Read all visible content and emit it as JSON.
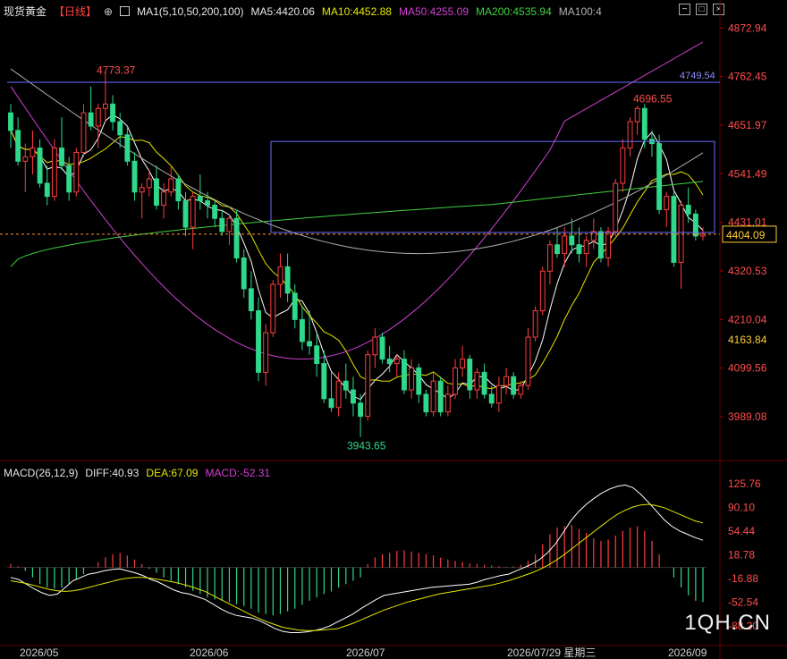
{
  "header": {
    "symbol": "现货黄金",
    "period": "【日线】",
    "ma_def": "MA1(5,10,50,200,100)",
    "ma5": "MA5:4420.06",
    "ma10": "MA10:4452.88",
    "ma50": "MA50:4255.09",
    "ma200": "MA200:4535.94",
    "ma100": "MA100:4"
  },
  "macd_header": {
    "name": "MACD(26,12,9)",
    "diff": "DIFF:40.93",
    "dea": "DEA:67.09",
    "macd": "MACD:-52.31"
  },
  "colors": {
    "up": "#ff3d3d",
    "down": "#2fd88a",
    "ma5": "#ffffff",
    "ma10": "#e6e600",
    "ma50": "#d040d0",
    "ma200": "#40d040",
    "ma100": "#b0b0b0",
    "rect": "#6a6aff",
    "hline": "#6a6aff",
    "last": "#ffcc33"
  },
  "watermark": "1QH.CN",
  "chart_data": {
    "type": "candlestick",
    "y_ticks": [
      "4872.94",
      "4762.45",
      "4651.97",
      "4541.49",
      "4431.01",
      "4320.53",
      "4210.04",
      "4099.56",
      "3989.08"
    ],
    "ylim": [
      3920,
      4900
    ],
    "x_labels": [
      "2026/05",
      "2026/06",
      "2026/07",
      "2026/07/29 星期三",
      "2026/09"
    ],
    "annotations": {
      "high1": "4773.37",
      "high2": "4696.55",
      "low": "3943.65",
      "hline": "4749.54",
      "last": "4404.09",
      "level": "4163.84"
    },
    "candles": [
      [
        4680,
        4700,
        4600,
        4640
      ],
      [
        4640,
        4670,
        4560,
        4570
      ],
      [
        4570,
        4610,
        4500,
        4580
      ],
      [
        4580,
        4640,
        4540,
        4600
      ],
      [
        4600,
        4620,
        4510,
        4520
      ],
      [
        4520,
        4560,
        4470,
        4490
      ],
      [
        4490,
        4620,
        4480,
        4600
      ],
      [
        4600,
        4670,
        4550,
        4560
      ],
      [
        4560,
        4580,
        4480,
        4500
      ],
      [
        4500,
        4600,
        4490,
        4590
      ],
      [
        4590,
        4700,
        4580,
        4680
      ],
      [
        4680,
        4740,
        4640,
        4650
      ],
      [
        4650,
        4700,
        4600,
        4690
      ],
      [
        4690,
        4773,
        4660,
        4700
      ],
      [
        4700,
        4720,
        4640,
        4660
      ],
      [
        4660,
        4680,
        4600,
        4630
      ],
      [
        4630,
        4650,
        4560,
        4570
      ],
      [
        4570,
        4590,
        4480,
        4500
      ],
      [
        4500,
        4520,
        4440,
        4510
      ],
      [
        4510,
        4550,
        4490,
        4530
      ],
      [
        4530,
        4560,
        4460,
        4470
      ],
      [
        4470,
        4520,
        4440,
        4500
      ],
      [
        4500,
        4560,
        4490,
        4530
      ],
      [
        4530,
        4540,
        4460,
        4480
      ],
      [
        4480,
        4500,
        4400,
        4420
      ],
      [
        4420,
        4500,
        4370,
        4490
      ],
      [
        4490,
        4540,
        4460,
        4480
      ],
      [
        4480,
        4500,
        4440,
        4470
      ],
      [
        4470,
        4480,
        4420,
        4440
      ],
      [
        4440,
        4460,
        4400,
        4410
      ],
      [
        4410,
        4450,
        4380,
        4440
      ],
      [
        4440,
        4460,
        4340,
        4350
      ],
      [
        4350,
        4370,
        4260,
        4280
      ],
      [
        4280,
        4320,
        4210,
        4230
      ],
      [
        4230,
        4260,
        4070,
        4090
      ],
      [
        4090,
        4200,
        4060,
        4180
      ],
      [
        4180,
        4300,
        4170,
        4290
      ],
      [
        4290,
        4360,
        4260,
        4330
      ],
      [
        4330,
        4360,
        4250,
        4270
      ],
      [
        4270,
        4290,
        4190,
        4210
      ],
      [
        4210,
        4240,
        4140,
        4160
      ],
      [
        4160,
        4230,
        4130,
        4150
      ],
      [
        4150,
        4180,
        4080,
        4110
      ],
      [
        4110,
        4140,
        4020,
        4030
      ],
      [
        4030,
        4090,
        4000,
        4010
      ],
      [
        4010,
        4090,
        3990,
        4070
      ],
      [
        4070,
        4110,
        4030,
        4050
      ],
      [
        4050,
        4080,
        3990,
        4020
      ],
      [
        4020,
        4040,
        3943,
        3990
      ],
      [
        3990,
        4140,
        3980,
        4130
      ],
      [
        4130,
        4190,
        4100,
        4170
      ],
      [
        4170,
        4180,
        4110,
        4120
      ],
      [
        4120,
        4150,
        4090,
        4110
      ],
      [
        4110,
        4130,
        4080,
        4120
      ],
      [
        4120,
        4140,
        4040,
        4050
      ],
      [
        4050,
        4120,
        4030,
        4100
      ],
      [
        4100,
        4110,
        4020,
        4040
      ],
      [
        4040,
        4050,
        3990,
        4000
      ],
      [
        4000,
        4090,
        3990,
        4070
      ],
      [
        4070,
        4080,
        3990,
        4000
      ],
      [
        4000,
        4060,
        3990,
        4040
      ],
      [
        4040,
        4120,
        4030,
        4100
      ],
      [
        4100,
        4150,
        4080,
        4120
      ],
      [
        4120,
        4130,
        4030,
        4050
      ],
      [
        4050,
        4100,
        4030,
        4090
      ],
      [
        4090,
        4110,
        4030,
        4040
      ],
      [
        4040,
        4060,
        4010,
        4020
      ],
      [
        4020,
        4080,
        4000,
        4060
      ],
      [
        4060,
        4100,
        4040,
        4080
      ],
      [
        4080,
        4090,
        4030,
        4040
      ],
      [
        4040,
        4070,
        4030,
        4060
      ],
      [
        4060,
        4190,
        4050,
        4170
      ],
      [
        4170,
        4240,
        4160,
        4230
      ],
      [
        4230,
        4330,
        4220,
        4320
      ],
      [
        4320,
        4390,
        4290,
        4380
      ],
      [
        4380,
        4420,
        4350,
        4360
      ],
      [
        4360,
        4420,
        4330,
        4400
      ],
      [
        4400,
        4440,
        4360,
        4380
      ],
      [
        4380,
        4420,
        4340,
        4360
      ],
      [
        4360,
        4400,
        4330,
        4390
      ],
      [
        4390,
        4440,
        4370,
        4410
      ],
      [
        4410,
        4420,
        4340,
        4350
      ],
      [
        4350,
        4420,
        4330,
        4410
      ],
      [
        4410,
        4530,
        4400,
        4520
      ],
      [
        4520,
        4620,
        4500,
        4600
      ],
      [
        4600,
        4670,
        4580,
        4660
      ],
      [
        4660,
        4696,
        4630,
        4690
      ],
      [
        4690,
        4700,
        4600,
        4620
      ],
      [
        4620,
        4640,
        4580,
        4610
      ],
      [
        4610,
        4630,
        4450,
        4460
      ],
      [
        4460,
        4500,
        4420,
        4490
      ],
      [
        4490,
        4500,
        4330,
        4340
      ],
      [
        4340,
        4480,
        4280,
        4470
      ],
      [
        4470,
        4510,
        4430,
        4450
      ],
      [
        4450,
        4460,
        4390,
        4400
      ],
      [
        4400,
        4420,
        4390,
        4404
      ]
    ],
    "macd_ticks": [
      "125.76",
      "90.10",
      "54.44",
      "18.78",
      "-16.88",
      "-52.54",
      "-88.20"
    ],
    "macd_ylim": [
      -104,
      134
    ],
    "macd_hist": [
      5,
      2,
      -5,
      -15,
      -25,
      -30,
      -32,
      -30,
      -25,
      -18,
      -10,
      0,
      8,
      15,
      20,
      22,
      18,
      12,
      5,
      -2,
      -8,
      -15,
      -20,
      -25,
      -30,
      -35,
      -40,
      -45,
      -48,
      -50,
      -52,
      -55,
      -58,
      -62,
      -68,
      -70,
      -72,
      -70,
      -66,
      -62,
      -56,
      -50,
      -45,
      -40,
      -36,
      -30,
      -25,
      -20,
      -15,
      5,
      15,
      20,
      22,
      25,
      26,
      24,
      22,
      20,
      18,
      15,
      12,
      10,
      8,
      6,
      5,
      4,
      3,
      2,
      1,
      2,
      4,
      10,
      20,
      35,
      50,
      60,
      62,
      64,
      58,
      52,
      44,
      40,
      42,
      48,
      55,
      60,
      62,
      55,
      40,
      20,
      0,
      -15,
      -30,
      -42,
      -50,
      -52
    ],
    "macd_diff": [
      -15,
      -18,
      -25,
      -32,
      -38,
      -42,
      -40,
      -30,
      -20,
      -15,
      -10,
      -8,
      -5,
      -3,
      -2,
      -5,
      -8,
      -12,
      -18,
      -22,
      -28,
      -34,
      -38,
      -40,
      -44,
      -48,
      -55,
      -62,
      -68,
      -72,
      -74,
      -76,
      -80,
      -86,
      -92,
      -96,
      -98,
      -98,
      -97,
      -95,
      -92,
      -88,
      -82,
      -76,
      -70,
      -62,
      -55,
      -48,
      -42,
      -40,
      -38,
      -36,
      -34,
      -32,
      -30,
      -29,
      -28,
      -27,
      -26,
      -25,
      -22,
      -18,
      -15,
      -12,
      -10,
      -5,
      0,
      5,
      12,
      22,
      35,
      52,
      70,
      84,
      95,
      104,
      112,
      118,
      122,
      124,
      120,
      110,
      98,
      85,
      72,
      62,
      55,
      50,
      45,
      41
    ],
    "macd_dea": [
      -20,
      -22,
      -24,
      -27,
      -30,
      -33,
      -35,
      -36,
      -35,
      -33,
      -30,
      -27,
      -24,
      -21,
      -18,
      -16,
      -15,
      -15,
      -16,
      -18,
      -20,
      -22,
      -25,
      -28,
      -32,
      -36,
      -42,
      -48,
      -54,
      -60,
      -66,
      -72,
      -77,
      -82,
      -86,
      -90,
      -92,
      -94,
      -95,
      -95,
      -94,
      -93,
      -92,
      -88,
      -84,
      -79,
      -74,
      -69,
      -64,
      -60,
      -56,
      -52,
      -49,
      -46,
      -43,
      -40,
      -38,
      -36,
      -34,
      -32,
      -30,
      -28,
      -26,
      -23,
      -20,
      -16,
      -12,
      -8,
      -3,
      3,
      10,
      18,
      27,
      36,
      45,
      54,
      63,
      72,
      80,
      86,
      91,
      94,
      95,
      93,
      90,
      85,
      80,
      75,
      70,
      67
    ]
  }
}
